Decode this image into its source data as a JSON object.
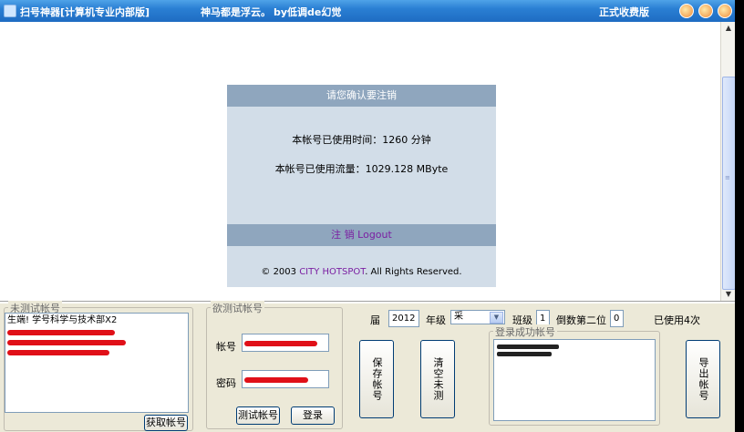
{
  "titlebar": {
    "app_title": "扫号神器[计算机专业内部版]",
    "slogan": "神马都是浮云。",
    "author": "by低调de幻觉",
    "edition": "正式收费版"
  },
  "notice": {
    "header": "请您确认要注销",
    "time_used": "本帐号已使用时间：1260 分钟",
    "traffic_used": "本帐号已使用流量：1029.128 MByte",
    "logout": "注 销 Logout",
    "copyright_prefix": "© 2003 ",
    "copyright_brand": "CITY HOTSPOT",
    "copyright_suffix": ". All Rights Reserved."
  },
  "untested": {
    "legend": "未测试帐号",
    "rows": [
      "生端! 学号科学与技术部X2",
      "",
      "",
      ""
    ],
    "fetch_button": "获取帐号"
  },
  "test_account": {
    "legend": "欲测试帐号",
    "account_label": "帐号",
    "password_label": "密码",
    "test_button": "测试帐号",
    "login_button": "登录"
  },
  "controls": {
    "grade_label": "届",
    "grade_value": "2012",
    "year_label": "年级",
    "dept_value": "采",
    "class_label": "班级",
    "class_value": "1",
    "second_last_label": "倒数第二位",
    "second_last_value": "0",
    "used_count": "已使用4次"
  },
  "buttons": {
    "save": "保存帐号",
    "clear": "清空未测",
    "export": "导出帐号"
  },
  "success": {
    "legend": "登录成功帐号"
  }
}
